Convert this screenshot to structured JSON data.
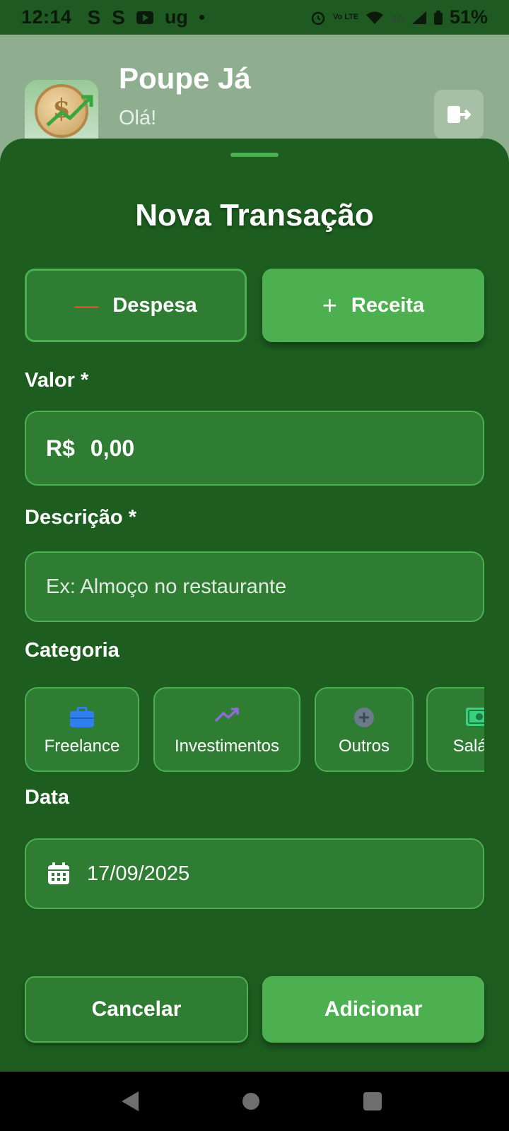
{
  "status_bar": {
    "time": "12:14",
    "notifications": [
      "S",
      "S",
      "youtube-icon",
      "ug",
      "dot"
    ],
    "network_label": "Vo LTE",
    "signal_label": "4G",
    "battery": "51%"
  },
  "app": {
    "title": "Poupe Já",
    "greeting": "Olá!",
    "logo_icon": "coin-growth-icon",
    "logout_icon": "logout-icon"
  },
  "sheet": {
    "title": "Nova Transação",
    "type_options": [
      {
        "label": "Despesa",
        "symbol": "—",
        "icon": "minus-icon",
        "selected": false
      },
      {
        "label": "Receita",
        "symbol": "+",
        "icon": "plus-icon",
        "selected": true
      }
    ],
    "amount": {
      "label": "Valor *",
      "currency": "R$",
      "value": "0,00"
    },
    "description": {
      "label": "Descrição *",
      "placeholder": "Ex: Almoço no restaurante",
      "value": ""
    },
    "category": {
      "label": "Categoria",
      "items": [
        {
          "label": "Freelance",
          "icon": "briefcase-icon",
          "color": "#2f80ed"
        },
        {
          "label": "Investimentos",
          "icon": "trending-up-icon",
          "color": "#8e6bd8"
        },
        {
          "label": "Outros",
          "icon": "plus-circle-icon",
          "color": "#6b7b8c"
        },
        {
          "label": "Salário",
          "icon": "money-icon",
          "color": "#3ad17a"
        }
      ]
    },
    "date": {
      "label": "Data",
      "value": "17/09/2025",
      "icon": "calendar-icon"
    },
    "buttons": {
      "cancel": "Cancelar",
      "submit": "Adicionar"
    }
  },
  "colors": {
    "sheet_bg": "#1d5e20",
    "field_bg": "#2e7d32",
    "accent": "#4caf50",
    "expense_accent": "#e0542c"
  }
}
